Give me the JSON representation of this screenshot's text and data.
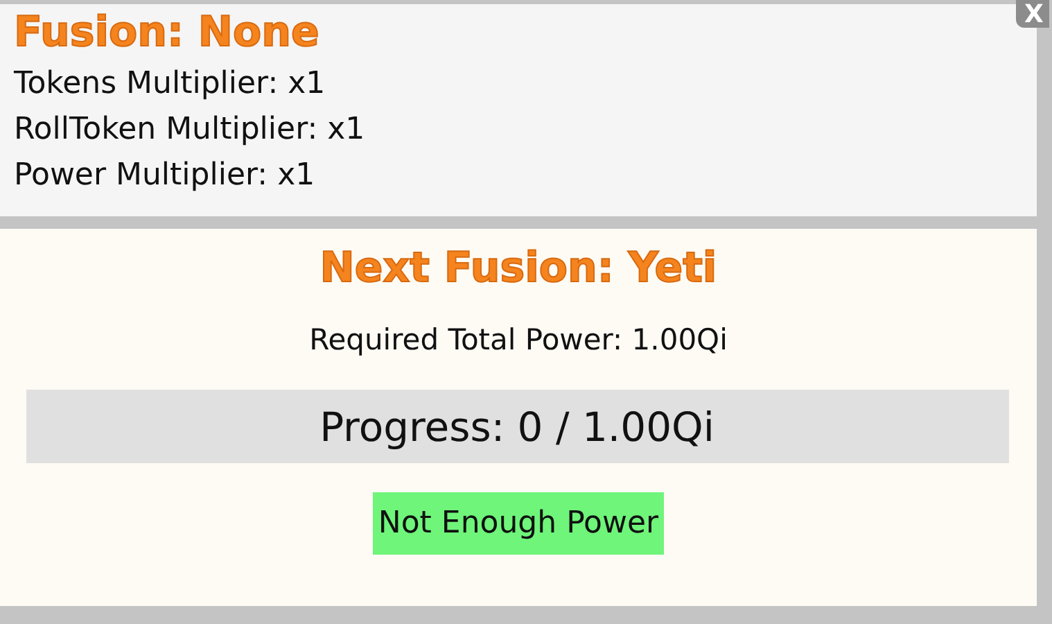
{
  "close_button": {
    "label": "X"
  },
  "current_fusion": {
    "title": "Fusion: None",
    "stats": [
      "Tokens Multiplier: x1",
      "RollToken Multiplier: x1",
      "Power Multiplier: x1"
    ]
  },
  "next_fusion": {
    "title": "Next Fusion: Yeti",
    "requirement": "Required Total Power: 1.00Qi",
    "progress": {
      "label": "Progress: 0 / 1.00Qi",
      "level": 0
    },
    "button": {
      "label": "Not Enough Power",
      "disabled": true
    }
  }
}
